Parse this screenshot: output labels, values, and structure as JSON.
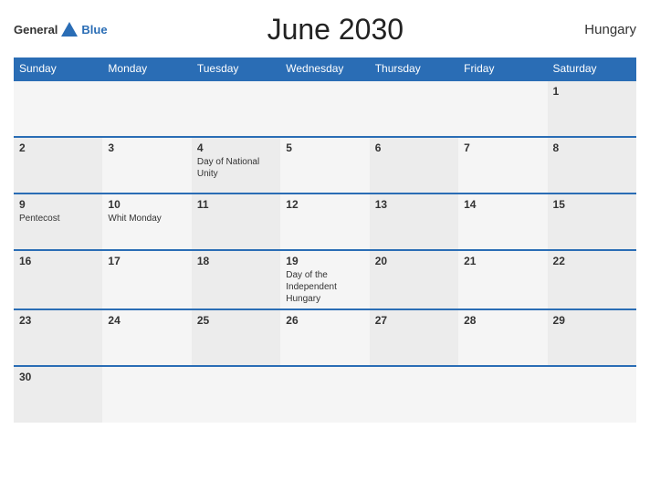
{
  "header": {
    "logo_general": "General",
    "logo_blue": "Blue",
    "title": "June 2030",
    "country": "Hungary"
  },
  "weekdays": [
    "Sunday",
    "Monday",
    "Tuesday",
    "Wednesday",
    "Thursday",
    "Friday",
    "Saturday"
  ],
  "weeks": [
    [
      {
        "day": "",
        "event": ""
      },
      {
        "day": "",
        "event": ""
      },
      {
        "day": "",
        "event": ""
      },
      {
        "day": "",
        "event": ""
      },
      {
        "day": "",
        "event": ""
      },
      {
        "day": "",
        "event": ""
      },
      {
        "day": "1",
        "event": ""
      }
    ],
    [
      {
        "day": "2",
        "event": ""
      },
      {
        "day": "3",
        "event": ""
      },
      {
        "day": "4",
        "event": "Day of National Unity"
      },
      {
        "day": "5",
        "event": ""
      },
      {
        "day": "6",
        "event": ""
      },
      {
        "day": "7",
        "event": ""
      },
      {
        "day": "8",
        "event": ""
      }
    ],
    [
      {
        "day": "9",
        "event": "Pentecost"
      },
      {
        "day": "10",
        "event": "Whit Monday"
      },
      {
        "day": "11",
        "event": ""
      },
      {
        "day": "12",
        "event": ""
      },
      {
        "day": "13",
        "event": ""
      },
      {
        "day": "14",
        "event": ""
      },
      {
        "day": "15",
        "event": ""
      }
    ],
    [
      {
        "day": "16",
        "event": ""
      },
      {
        "day": "17",
        "event": ""
      },
      {
        "day": "18",
        "event": ""
      },
      {
        "day": "19",
        "event": "Day of the Independent Hungary"
      },
      {
        "day": "20",
        "event": ""
      },
      {
        "day": "21",
        "event": ""
      },
      {
        "day": "22",
        "event": ""
      }
    ],
    [
      {
        "day": "23",
        "event": ""
      },
      {
        "day": "24",
        "event": ""
      },
      {
        "day": "25",
        "event": ""
      },
      {
        "day": "26",
        "event": ""
      },
      {
        "day": "27",
        "event": ""
      },
      {
        "day": "28",
        "event": ""
      },
      {
        "day": "29",
        "event": ""
      }
    ],
    [
      {
        "day": "30",
        "event": ""
      },
      {
        "day": "",
        "event": ""
      },
      {
        "day": "",
        "event": ""
      },
      {
        "day": "",
        "event": ""
      },
      {
        "day": "",
        "event": ""
      },
      {
        "day": "",
        "event": ""
      },
      {
        "day": "",
        "event": ""
      }
    ]
  ]
}
